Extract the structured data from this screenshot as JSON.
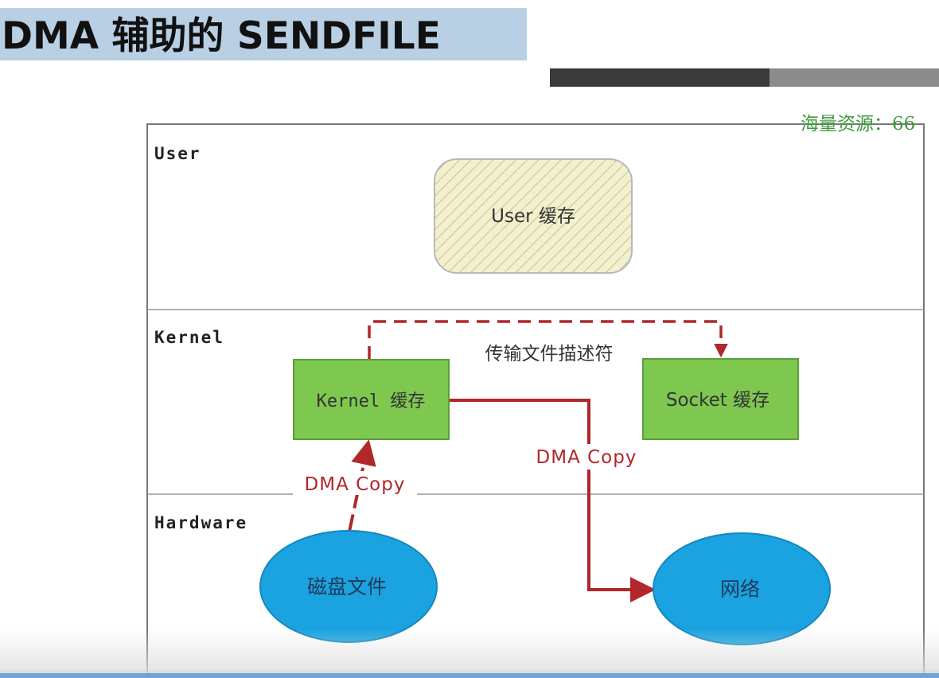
{
  "title": "DMA 辅助的 SENDFILE",
  "watermark": "海量资源：66",
  "sections": {
    "user": "User",
    "kernel": "Kernel",
    "hardware": "Hardware"
  },
  "boxes": {
    "user_buffer": "User 缓存",
    "kernel_buffer": "Kernel 缓存",
    "socket_buffer": "Socket 缓存"
  },
  "ellipses": {
    "disk_file": "磁盘文件",
    "network": "网络"
  },
  "arrows": {
    "descriptor_label": "传输文件描述符",
    "dma_copy_disk": "DMA Copy",
    "dma_copy_net": "DMA Copy"
  },
  "colors": {
    "title_bg": "#b9cfe4",
    "box_green": "#7ec850",
    "ellipse_blue": "#1aa3e0",
    "arrow_red": "#b1272a",
    "user_hatch_bg": "#f3f0cf"
  }
}
